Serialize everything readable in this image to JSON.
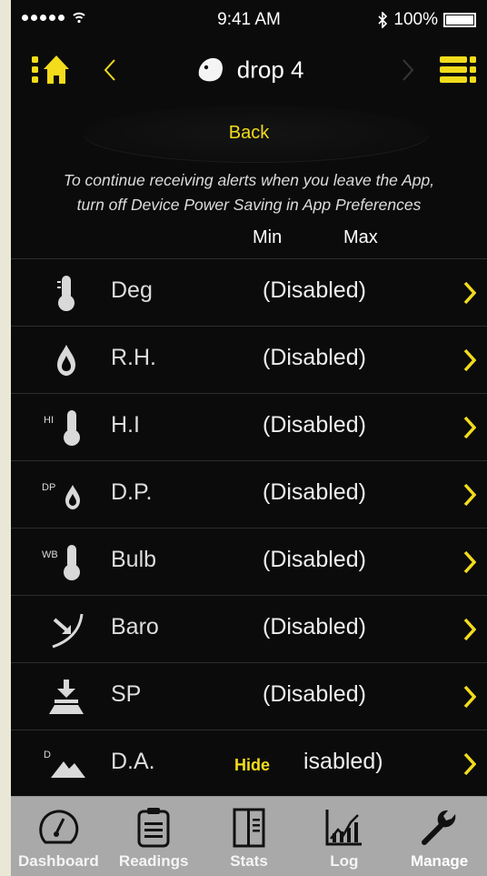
{
  "status_bar": {
    "time": "9:41 AM",
    "battery": "100%",
    "bluetooth_glyph": "∗"
  },
  "nav": {
    "title": "drop 4"
  },
  "back_label": "Back",
  "note": [
    "To continue receiving alerts when you leave the App,",
    "turn off Device Power Saving in App Preferences"
  ],
  "columns": {
    "min": "Min",
    "max": "Max"
  },
  "rows": [
    {
      "label": "Deg",
      "value": "(Disabled)",
      "icon": "thermometer-icon"
    },
    {
      "label": "R.H.",
      "value": "(Disabled)",
      "icon": "humidity-drop-icon"
    },
    {
      "label": "H.I",
      "value": "(Disabled)",
      "icon": "heat-index-icon",
      "icon_text": "HI"
    },
    {
      "label": "D.P.",
      "value": "(Disabled)",
      "icon": "dew-point-icon",
      "icon_text": "DP"
    },
    {
      "label": "Bulb",
      "value": "(Disabled)",
      "icon": "wet-bulb-icon",
      "icon_text": "WB"
    },
    {
      "label": "Baro",
      "value": "(Disabled)",
      "icon": "barometer-icon"
    },
    {
      "label": "SP",
      "value": "(Disabled)",
      "icon": "station-pressure-icon"
    },
    {
      "label": "D.A.",
      "value": "isabled)",
      "icon": "density-altitude-icon",
      "icon_text": "D"
    }
  ],
  "hide_label": "Hide",
  "tabs": [
    {
      "label": "Dashboard",
      "icon": "gauge-icon"
    },
    {
      "label": "Readings",
      "icon": "clipboard-icon"
    },
    {
      "label": "Stats",
      "icon": "stats-book-icon"
    },
    {
      "label": "Log",
      "icon": "graph-icon"
    },
    {
      "label": "Manage",
      "icon": "wrench-icon",
      "active": true
    }
  ],
  "colors": {
    "accent": "#f2dc1b",
    "background": "#0b0b0b",
    "tab_bar": "#a9a9a9"
  }
}
